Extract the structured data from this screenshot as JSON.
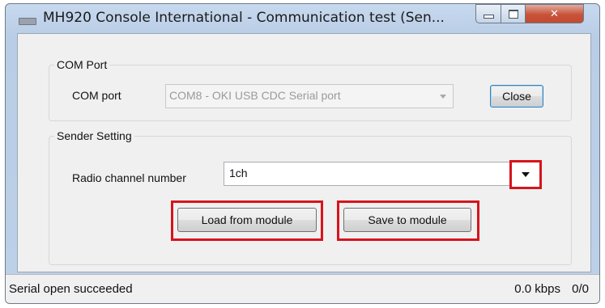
{
  "window": {
    "title": "MH920 Console International - Communication test (Sen..."
  },
  "com_port": {
    "group_label": "COM Port",
    "field_label": "COM port",
    "selected": "COM8 - OKI USB CDC Serial port",
    "close_label": "Close"
  },
  "sender": {
    "group_label": "Sender Setting",
    "channel_label": "Radio channel number",
    "channel_value": "1ch",
    "load_label": "Load from module",
    "save_label": "Save to module"
  },
  "status": {
    "message": "Serial open succeeded",
    "rate": "0.0 kbps",
    "count": "0/0"
  },
  "icons": {
    "close": "x-icon",
    "minimize": "minimize-icon",
    "maximize": "maximize-icon",
    "dropdown": "chevron-down-icon"
  },
  "colors": {
    "highlight": "#d6141d",
    "titlebar": "#c7d9ee",
    "close_button": "#c8523a"
  }
}
